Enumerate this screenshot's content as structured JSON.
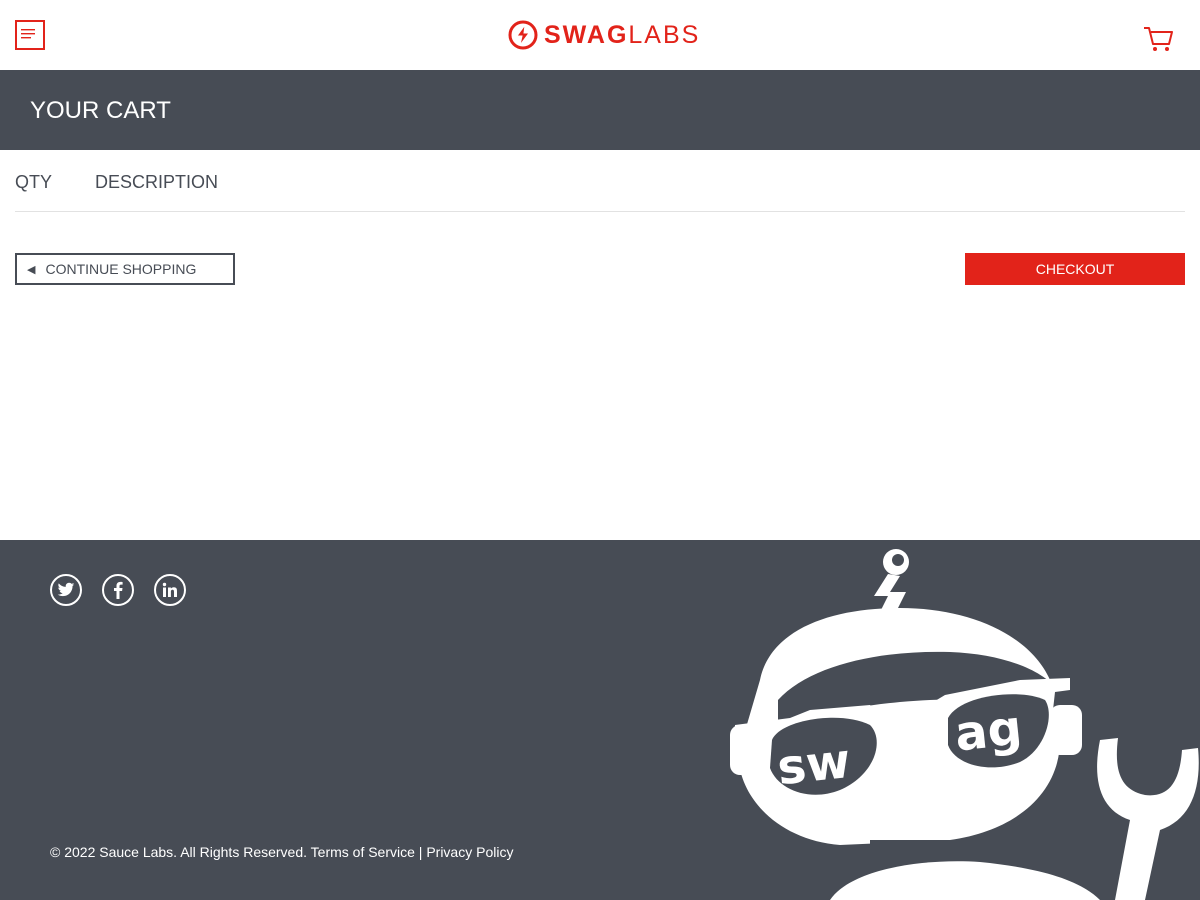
{
  "header": {
    "brand_bold": "SWAG",
    "brand_light": "LABS"
  },
  "page": {
    "title": "YOUR CART"
  },
  "cart": {
    "qty_label": "QTY",
    "description_label": "DESCRIPTION"
  },
  "buttons": {
    "continue_label": "CONTINUE SHOPPING",
    "checkout_label": "CHECKOUT"
  },
  "footer": {
    "copyright": "© 2022 Sauce Labs. All Rights Reserved. Terms of Service | Privacy Policy",
    "social": [
      "twitter-icon",
      "facebook-icon",
      "linkedin-icon"
    ],
    "mascot_text_left": "sw",
    "mascot_text_right": "ag"
  },
  "colors": {
    "accent": "#e2231a",
    "dark": "#474c55",
    "divider": "#e2e2e2"
  }
}
